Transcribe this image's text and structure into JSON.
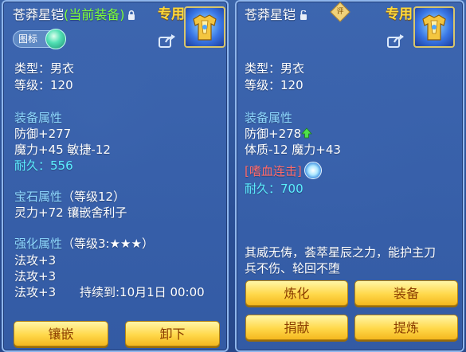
{
  "left_panel": {
    "title_name": "苍莽星铠",
    "title_status": "(当前装备)",
    "exclusive": "专用",
    "chip_label": "图标",
    "type": "类型：男衣",
    "level": "等级：120",
    "equip_attr_header": "装备属性",
    "defense": "防御+277",
    "magic_agility": "魔力+45 敏捷-12",
    "durability_label": "耐久：",
    "durability_value": "556",
    "gem_header": "宝石属性",
    "gem_level": "（等级12）",
    "gem_line": "灵力+72 镶嵌舍利子",
    "enhance_header": "强化属性",
    "enhance_level": "（等级3:★★★）",
    "enhance_1": "法攻+3",
    "enhance_2": "法攻+3",
    "enhance_3": "法攻+3",
    "duration": "持续到:10月1日 00:00",
    "buttons": [
      "镶嵌",
      "卸下"
    ]
  },
  "right_panel": {
    "title_name": "苍莽星铠",
    "diamond_label": "评",
    "exclusive": "专用",
    "type": "类型：男衣",
    "level": "等级：120",
    "equip_attr_header": "装备属性",
    "defense": "防御+278",
    "physique_magic": "体质-12 魔力+43",
    "special_skill": "[嗜血连击]",
    "durability_label": "耐久：",
    "durability_value": "700",
    "description_line1": "其威无俦，荟萃星辰之力，能护主刀",
    "description_line2": "兵不伤、轮回不堕",
    "buttons": [
      "炼化",
      "装备",
      "捐献",
      "提炼"
    ]
  },
  "colors": {
    "panel_bg": "#3d66b0",
    "section_header": "#8fd9ff",
    "durability": "#5cf0ff",
    "current_equip": "#7dff3a",
    "exclusive": "#ffd93a",
    "skill_red": "#ff6a6a",
    "button_gold": "#ffd84a"
  },
  "icons": {
    "lock": "lock-icon",
    "unlock": "unlock-icon",
    "share": "share-icon",
    "armor": "armor-item-icon",
    "up_arrow": "green-up-arrow-icon",
    "skill": "swirl-skill-icon"
  }
}
